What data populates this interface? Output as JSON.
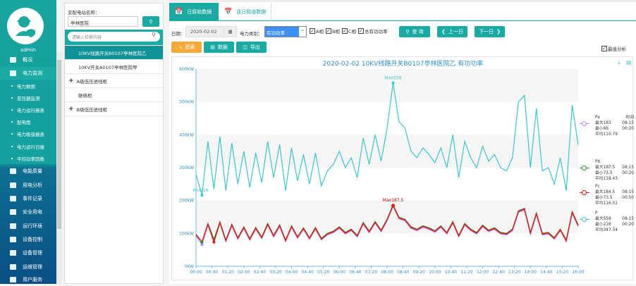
{
  "user": {
    "name": "admin"
  },
  "sidebar": {
    "items": [
      {
        "label": "概况",
        "icon": "monitor-icon"
      },
      {
        "label": "电力监测",
        "icon": "power-icon",
        "active": true
      },
      {
        "label": "电能质量",
        "icon": "quality-icon"
      },
      {
        "label": "用电分析",
        "icon": "bar-chart-icon"
      },
      {
        "label": "事件记录",
        "icon": "record-icon"
      },
      {
        "label": "安全用电",
        "icon": "alarm-icon"
      },
      {
        "label": "运行环境",
        "icon": "camera-icon"
      },
      {
        "label": "设备控制",
        "icon": "control-icon"
      },
      {
        "label": "设备管理",
        "icon": "device-icon"
      },
      {
        "label": "运维管理",
        "icon": "maintenance-icon"
      },
      {
        "label": "用户服务",
        "icon": "edit-icon"
      }
    ],
    "subitems": [
      "电力数据",
      "变压器监测",
      "电力运行报表",
      "配电图",
      "电力极值报表",
      "电力运行日报",
      "平均功率因数"
    ]
  },
  "tree": {
    "station_label": "变配电站名称：",
    "station_value": "亭林医院",
    "search_placeholder": "请输入检索内容",
    "items": [
      {
        "label": "10KV线路开关B0107亭林医院乙",
        "selected": true
      },
      {
        "label": "10KV开关A0107亭林医院甲"
      },
      {
        "label": "A级低压进线柜",
        "expand": "+"
      },
      {
        "label": "联络柜"
      },
      {
        "label": "B级低压进线柜",
        "expand": "+"
      }
    ]
  },
  "tabs": [
    {
      "label": "日原始数据",
      "active": true
    },
    {
      "label": "逐日极值数据"
    }
  ],
  "toolbar": {
    "date_label": "日期：",
    "date_value": "2020-02-02",
    "type_label": "电力类别：",
    "type_value": "有功功率",
    "checks": [
      "A相",
      "B相",
      "C相",
      "总有功功率"
    ],
    "query": "查 询",
    "prev": "上一日",
    "next": "下一日",
    "chart_btn": "图表",
    "data_btn": "数据",
    "export_btn": "导出",
    "extreme_label": "最值分析"
  },
  "colors": {
    "P": "#3cc6c8",
    "Pa": "#b38cff",
    "Pb": "#2a8f2a",
    "Pc": "#ee1111",
    "accent": "#19aaa3",
    "orange": "#f7a93c"
  },
  "legend": [
    {
      "name": "Pa",
      "time_head": "时间",
      "max": "最大183",
      "max_t": "08:15",
      "min": "最小66",
      "min_t": "00:20",
      "avg": "平均110.79"
    },
    {
      "name": "Pb",
      "max": "最大187.5",
      "max_t": "08:15",
      "min": "最小73.5",
      "min_t": "00:20",
      "avg": "平均118.43"
    },
    {
      "name": "Pc",
      "max": "最大184.5",
      "max_t": "08:15",
      "min": "最小73.5",
      "min_t": "00:50",
      "avg": "平均116.51"
    },
    {
      "name": "P",
      "max": "最大558",
      "max_t": "08:15",
      "min": "最小216",
      "min_t": "00:20",
      "avg": "平均347.34"
    }
  ],
  "chart_data": {
    "type": "line",
    "title": "2020-02-02  10KV线路开关B0107亭林医院乙  有功功率",
    "ylim": [
      0,
      600
    ],
    "yticks": [
      "0kW",
      "100kW",
      "200kW",
      "300kW",
      "400kW",
      "500kW",
      "600kW"
    ],
    "xticks": [
      "00:00",
      "00:40",
      "01:20",
      "02:00",
      "02:40",
      "03:20",
      "04:00",
      "04:40",
      "05:20",
      "06:00",
      "06:40",
      "07:20",
      "08:00",
      "08:40",
      "09:20",
      "10:00",
      "10:40",
      "11:20",
      "12:00",
      "12:40",
      "13:20",
      "14:00",
      "14:40",
      "15:20",
      "16:00"
    ],
    "x_interval_min": 15,
    "annotations": {
      "P_max": "Max558",
      "P_min": "Min216",
      "Pc_max": "Max187.5"
    },
    "series": [
      {
        "name": "P",
        "values": [
          280,
          216,
          380,
          235,
          395,
          230,
          375,
          250,
          350,
          240,
          345,
          255,
          380,
          270,
          370,
          230,
          360,
          260,
          340,
          250,
          345,
          245,
          290,
          310,
          350,
          300,
          330,
          270,
          390,
          310,
          400,
          320,
          420,
          558,
          440,
          420,
          350,
          330,
          360,
          340,
          315,
          360,
          300,
          400,
          270,
          380,
          330,
          300,
          365,
          320,
          340,
          300,
          290,
          330,
          500,
          520,
          300,
          480,
          290,
          300,
          250,
          330,
          230,
          490,
          370
        ]
      },
      {
        "name": "Pa",
        "values": [
          92,
          66,
          125,
          77,
          130,
          75,
          123,
          82,
          115,
          79,
          113,
          84,
          125,
          89,
          121,
          75,
          118,
          85,
          112,
          82,
          113,
          80,
          95,
          102,
          115,
          98,
          108,
          89,
          128,
          102,
          131,
          105,
          138,
          183,
          144,
          138,
          115,
          108,
          118,
          112,
          103,
          118,
          98,
          131,
          89,
          125,
          108,
          98,
          120,
          105,
          112,
          98,
          95,
          108,
          164,
          171,
          98,
          157,
          95,
          98,
          82,
          108,
          75,
          161,
          121
        ]
      },
      {
        "name": "Pb",
        "values": [
          97,
          73.5,
          130,
          82,
          135,
          80,
          128,
          87,
          120,
          84,
          118,
          89,
          130,
          94,
          126,
          80,
          123,
          90,
          117,
          87,
          118,
          85,
          100,
          107,
          120,
          103,
          113,
          94,
          133,
          107,
          136,
          110,
          143,
          187.5,
          149,
          143,
          120,
          113,
          123,
          117,
          108,
          123,
          103,
          136,
          94,
          130,
          113,
          103,
          125,
          110,
          117,
          103,
          100,
          113,
          169,
          176,
          103,
          162,
          100,
          103,
          87,
          113,
          80,
          166,
          126
        ]
      },
      {
        "name": "Pc",
        "values": [
          95,
          74,
          128,
          73.5,
          133,
          78,
          126,
          85,
          118,
          82,
          116,
          87,
          128,
          92,
          124,
          78,
          121,
          88,
          115,
          85,
          116,
          83,
          98,
          105,
          118,
          101,
          111,
          92,
          131,
          105,
          134,
          108,
          141,
          184.5,
          147,
          141,
          118,
          111,
          121,
          115,
          106,
          121,
          101,
          134,
          92,
          128,
          111,
          101,
          123,
          108,
          115,
          101,
          98,
          111,
          167,
          174,
          101,
          160,
          98,
          101,
          85,
          111,
          78,
          164,
          124
        ]
      }
    ]
  }
}
